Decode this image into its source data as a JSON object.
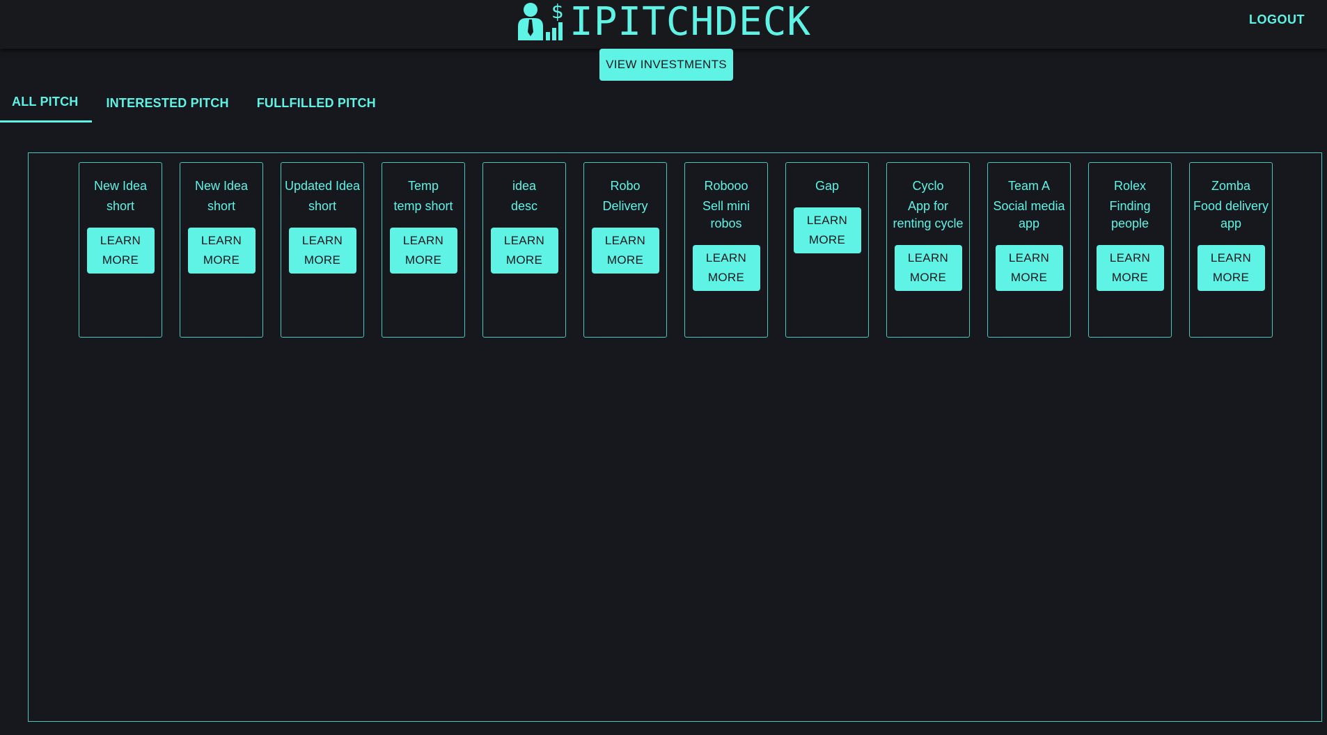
{
  "header": {
    "brand_text": "IPITCHDECK",
    "logo_icon": "investor-chart-dollar-icon",
    "logout_label": "LOGOUT"
  },
  "actions": {
    "view_investments_label": "VIEW INVESTMENTS"
  },
  "tabs": [
    {
      "label": "ALL PITCH",
      "active": true
    },
    {
      "label": "INTERESTED PITCH",
      "active": false
    },
    {
      "label": "FULLFILLED PITCH",
      "active": false
    }
  ],
  "pitches": [
    {
      "title": "New Idea",
      "desc": "short",
      "button": "LEARN MORE"
    },
    {
      "title": "New Idea",
      "desc": "short",
      "button": "LEARN MORE"
    },
    {
      "title": "Updated Idea",
      "desc": "short",
      "button": "LEARN MORE"
    },
    {
      "title": "Temp",
      "desc": "temp short",
      "button": "LEARN MORE"
    },
    {
      "title": "idea",
      "desc": "desc",
      "button": "LEARN MORE"
    },
    {
      "title": "Robo",
      "desc": "Delivery",
      "button": "LEARN MORE"
    },
    {
      "title": "Robooo",
      "desc": "Sell mini robos",
      "button": "LEARN MORE"
    },
    {
      "title": "Gap",
      "desc": "",
      "button": "LEARN MORE"
    },
    {
      "title": "Cyclo",
      "desc": "App for renting cycle",
      "button": "LEARN MORE"
    },
    {
      "title": "Team A",
      "desc": "Social media app",
      "button": "LEARN MORE"
    },
    {
      "title": "Rolex",
      "desc": "Finding people",
      "button": "LEARN MORE"
    },
    {
      "title": "Zomba",
      "desc": "Food delivery app",
      "button": "LEARN MORE"
    }
  ],
  "colors": {
    "accent": "#5ff3e6",
    "background": "#17181d",
    "border": "#49c9be"
  }
}
